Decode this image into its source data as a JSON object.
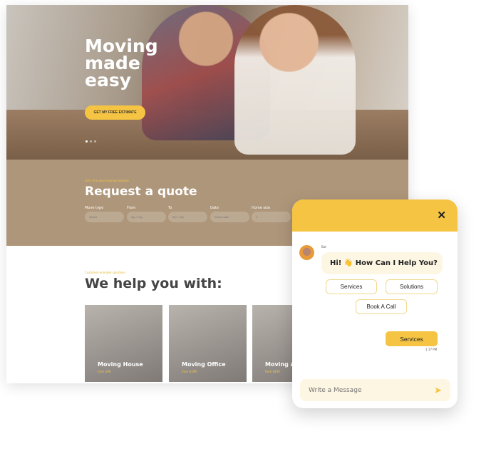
{
  "hero": {
    "title": "Moving made easy",
    "cta": "GET MY FREE ESTIMATE"
  },
  "quote": {
    "subtitle": "Let's find your moving solution",
    "title": "Request a quote",
    "fields": [
      {
        "label": "Move type",
        "value": "Select"
      },
      {
        "label": "From",
        "value": "Zip / City"
      },
      {
        "label": "To",
        "value": "Zip / City"
      },
      {
        "label": "Date",
        "value": "Select date"
      },
      {
        "label": "Home size",
        "value": "1"
      }
    ]
  },
  "services": {
    "subtitle": "Customer-oriented solutions",
    "title": "We help you with:",
    "cards": [
      {
        "title": "Moving House",
        "price": "from $99"
      },
      {
        "title": "Moving Office",
        "price": "from $199"
      },
      {
        "title": "Moving Apartment",
        "price": "from $449"
      }
    ]
  },
  "chat": {
    "bot_name": "Bot",
    "greeting": "Hi! 👋 How Can I Help You?",
    "options": [
      "Services",
      "Solutions",
      "Book A Call"
    ],
    "user_reply": "Services",
    "reply_time": "1:17 PM",
    "input_placeholder": "Write a Message",
    "accent": "#f6c443"
  }
}
